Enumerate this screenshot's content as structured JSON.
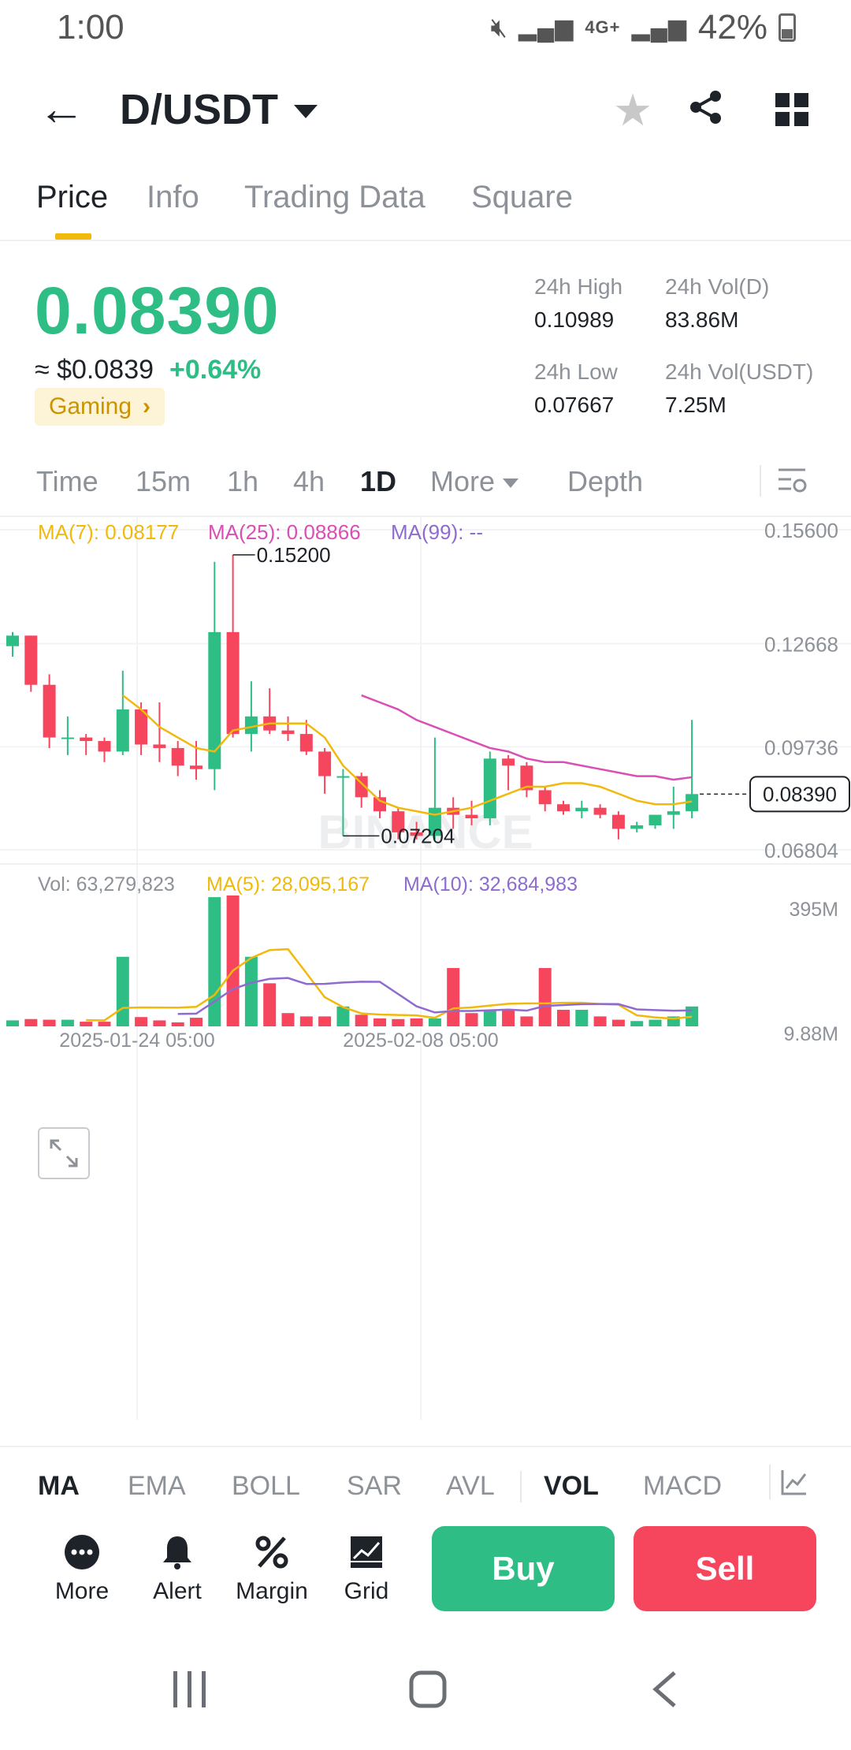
{
  "status_bar": {
    "time": "1:00",
    "network": "4G+",
    "battery": "42%"
  },
  "header": {
    "pair": "D/USDT"
  },
  "tabs": [
    {
      "label": "Price",
      "active": true
    },
    {
      "label": "Info"
    },
    {
      "label": "Trading Data"
    },
    {
      "label": "Square"
    }
  ],
  "ticker": {
    "last_price": "0.08390",
    "usd_price": "≈ $0.0839",
    "change": "+0.64%",
    "tag": "Gaming",
    "high_label": "24h High",
    "high": "0.10989",
    "vol_base_label": "24h Vol(D)",
    "vol_base": "83.86M",
    "low_label": "24h Low",
    "low": "0.07667",
    "vol_quote_label": "24h Vol(USDT)",
    "vol_quote": "7.25M"
  },
  "intervals": [
    "Time",
    "15m",
    "1h",
    "4h",
    "1D",
    "More",
    "Depth"
  ],
  "active_interval": "1D",
  "chart_data": {
    "type": "candlestick",
    "interval": "1D",
    "watermark": "BINANCE",
    "ma_legend": {
      "ma7": "MA(7): 0.08177",
      "ma25": "MA(25): 0.08866",
      "ma99": "MA(99): --"
    },
    "price_axis": [
      "0.15600",
      "0.12668",
      "0.09736",
      "0.06804"
    ],
    "ylim": [
      0.06804,
      0.156
    ],
    "current_price_label": "0.08390",
    "high_marker": "0.15200",
    "low_marker": "0.07204",
    "candles": [
      {
        "o": 0.126,
        "h": 0.13,
        "c": 0.129,
        "l": 0.123
      },
      {
        "o": 0.129,
        "h": 0.129,
        "c": 0.115,
        "l": 0.113
      },
      {
        "o": 0.115,
        "h": 0.118,
        "c": 0.1,
        "l": 0.097
      },
      {
        "o": 0.1,
        "h": 0.106,
        "c": 0.1,
        "l": 0.095
      },
      {
        "o": 0.1,
        "h": 0.101,
        "c": 0.099,
        "l": 0.095
      },
      {
        "o": 0.099,
        "h": 0.1,
        "c": 0.096,
        "l": 0.093
      },
      {
        "o": 0.096,
        "h": 0.119,
        "c": 0.108,
        "l": 0.095
      },
      {
        "o": 0.108,
        "h": 0.11,
        "c": 0.098,
        "l": 0.095
      },
      {
        "o": 0.098,
        "h": 0.11,
        "c": 0.097,
        "l": 0.093
      },
      {
        "o": 0.097,
        "h": 0.099,
        "c": 0.092,
        "l": 0.089
      },
      {
        "o": 0.092,
        "h": 0.099,
        "c": 0.091,
        "l": 0.088
      },
      {
        "o": 0.091,
        "h": 0.15,
        "c": 0.13,
        "l": 0.085
      },
      {
        "o": 0.13,
        "h": 0.152,
        "c": 0.101,
        "l": 0.1
      },
      {
        "o": 0.101,
        "h": 0.116,
        "c": 0.106,
        "l": 0.096
      },
      {
        "o": 0.106,
        "h": 0.114,
        "c": 0.102,
        "l": 0.101
      },
      {
        "o": 0.102,
        "h": 0.106,
        "c": 0.101,
        "l": 0.099
      },
      {
        "o": 0.101,
        "h": 0.105,
        "c": 0.096,
        "l": 0.095
      },
      {
        "o": 0.096,
        "h": 0.097,
        "c": 0.089,
        "l": 0.084
      },
      {
        "o": 0.089,
        "h": 0.091,
        "c": 0.089,
        "l": 0.072
      },
      {
        "o": 0.089,
        "h": 0.09,
        "c": 0.083,
        "l": 0.08
      },
      {
        "o": 0.083,
        "h": 0.085,
        "c": 0.079,
        "l": 0.077
      },
      {
        "o": 0.079,
        "h": 0.08,
        "c": 0.073,
        "l": 0.071
      },
      {
        "o": 0.073,
        "h": 0.076,
        "c": 0.072,
        "l": 0.071
      },
      {
        "o": 0.072,
        "h": 0.1,
        "c": 0.08,
        "l": 0.071
      },
      {
        "o": 0.08,
        "h": 0.083,
        "c": 0.078,
        "l": 0.074
      },
      {
        "o": 0.078,
        "h": 0.082,
        "c": 0.077,
        "l": 0.075
      },
      {
        "o": 0.077,
        "h": 0.096,
        "c": 0.094,
        "l": 0.075
      },
      {
        "o": 0.094,
        "h": 0.095,
        "c": 0.092,
        "l": 0.085
      },
      {
        "o": 0.092,
        "h": 0.093,
        "c": 0.085,
        "l": 0.083
      },
      {
        "o": 0.085,
        "h": 0.086,
        "c": 0.081,
        "l": 0.079
      },
      {
        "o": 0.081,
        "h": 0.082,
        "c": 0.079,
        "l": 0.078
      },
      {
        "o": 0.079,
        "h": 0.082,
        "c": 0.08,
        "l": 0.077
      },
      {
        "o": 0.08,
        "h": 0.081,
        "c": 0.078,
        "l": 0.077
      },
      {
        "o": 0.078,
        "h": 0.079,
        "c": 0.074,
        "l": 0.071
      },
      {
        "o": 0.074,
        "h": 0.076,
        "c": 0.075,
        "l": 0.073
      },
      {
        "o": 0.075,
        "h": 0.078,
        "c": 0.078,
        "l": 0.074
      },
      {
        "o": 0.078,
        "h": 0.086,
        "c": 0.079,
        "l": 0.074
      },
      {
        "o": 0.079,
        "h": 0.105,
        "c": 0.0839,
        "l": 0.077
      }
    ],
    "ma7": [
      null,
      null,
      null,
      null,
      null,
      null,
      0.112,
      0.108,
      0.103,
      0.1,
      0.097,
      0.096,
      0.102,
      0.103,
      0.104,
      0.104,
      0.104,
      0.1,
      0.092,
      0.087,
      0.082,
      0.08,
      0.079,
      0.078,
      0.079,
      0.08,
      0.082,
      0.084,
      0.086,
      0.086,
      0.087,
      0.087,
      0.086,
      0.084,
      0.082,
      0.081,
      0.081,
      0.0818
    ],
    "ma25": [
      null,
      null,
      null,
      null,
      null,
      null,
      null,
      null,
      null,
      null,
      null,
      null,
      null,
      null,
      null,
      null,
      null,
      null,
      null,
      0.112,
      0.11,
      0.108,
      0.105,
      0.103,
      0.101,
      0.099,
      0.097,
      0.096,
      0.094,
      0.093,
      0.093,
      0.092,
      0.091,
      0.09,
      0.089,
      0.089,
      0.088,
      0.0887
    ],
    "volume": {
      "legend_vol": "Vol: 63,279,823",
      "legend_ma5": "MA(5): 28,095,167",
      "legend_ma10": "MA(10): 32,684,983",
      "axis": [
        "395M",
        "9.88M"
      ],
      "ylim": [
        0,
        395
      ],
      "values": [
        18,
        22,
        20,
        20,
        14,
        14,
        210,
        28,
        18,
        12,
        26,
        390,
        395,
        210,
        130,
        40,
        30,
        30,
        60,
        35,
        24,
        22,
        24,
        24,
        176,
        40,
        50,
        50,
        30,
        176,
        50,
        50,
        30,
        20,
        16,
        20,
        30,
        60
      ]
    },
    "x_labels": [
      "2025-01-24 05:00",
      "2025-02-08 05:00"
    ]
  },
  "indicators": [
    "MA",
    "EMA",
    "BOLL",
    "SAR",
    "AVL",
    "VOL",
    "MACD"
  ],
  "active_indicators": [
    "MA",
    "VOL"
  ],
  "actions": [
    {
      "label": "More",
      "icon": "more-icon"
    },
    {
      "label": "Alert",
      "icon": "bell-icon"
    },
    {
      "label": "Margin",
      "icon": "percent-icon"
    },
    {
      "label": "Grid",
      "icon": "grid-bot-icon"
    }
  ],
  "buy_label": "Buy",
  "sell_label": "Sell",
  "colors": {
    "up": "#2ebd85",
    "down": "#f6465d",
    "ma7": "#f0b90b",
    "ma25": "#d94fb5",
    "ma99": "#8f6bcf",
    "accent": "#f0b90b"
  }
}
